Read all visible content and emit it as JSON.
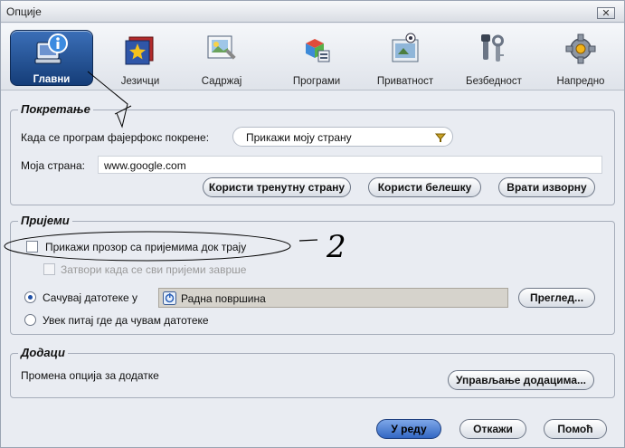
{
  "window": {
    "title": "Опције",
    "close_glyph": "✕"
  },
  "tabs": [
    {
      "label": "Главни",
      "icon": "main-icon",
      "active": true
    },
    {
      "label": "Језичци",
      "icon": "tabs-star-icon"
    },
    {
      "label": "Садржај",
      "icon": "content-icon"
    },
    {
      "label": "Програми",
      "icon": "applications-icon"
    },
    {
      "label": "Приватност",
      "icon": "privacy-icon"
    },
    {
      "label": "Безбедност",
      "icon": "security-icon"
    },
    {
      "label": "Напредно",
      "icon": "advanced-gear-icon"
    }
  ],
  "startup": {
    "legend": "Покретање",
    "when_label": "Када се програм фајерфокс покрене:",
    "when_value": "Прикажи моју страну",
    "home_label": "Моја страна:",
    "home_value": "www.google.com",
    "btn_current": "Користи тренутну страну",
    "btn_bookmark": "Користи белешку",
    "btn_default": "Врати изворну"
  },
  "downloads": {
    "legend": "Пријеми",
    "show_window": "Прикажи прозор са пријемима док трају",
    "close_when_done": "Затвори када се сви пријеми заврше",
    "save_to": "Сачувај датотеке у",
    "folder": "Радна површина",
    "browse": "Преглед...",
    "always_ask": "Увек питај где да чувам датотеке"
  },
  "addons": {
    "legend": "Додаци",
    "text": "Промена опција за додатке",
    "manage": "Управљање додацима..."
  },
  "footer": {
    "ok": "У реду",
    "cancel": "Откажи",
    "help": "Помоћ"
  },
  "annotations": {
    "number": "2"
  },
  "colors": {
    "accent": "#1e4fa6",
    "active_tab": "#2a5aa0"
  }
}
